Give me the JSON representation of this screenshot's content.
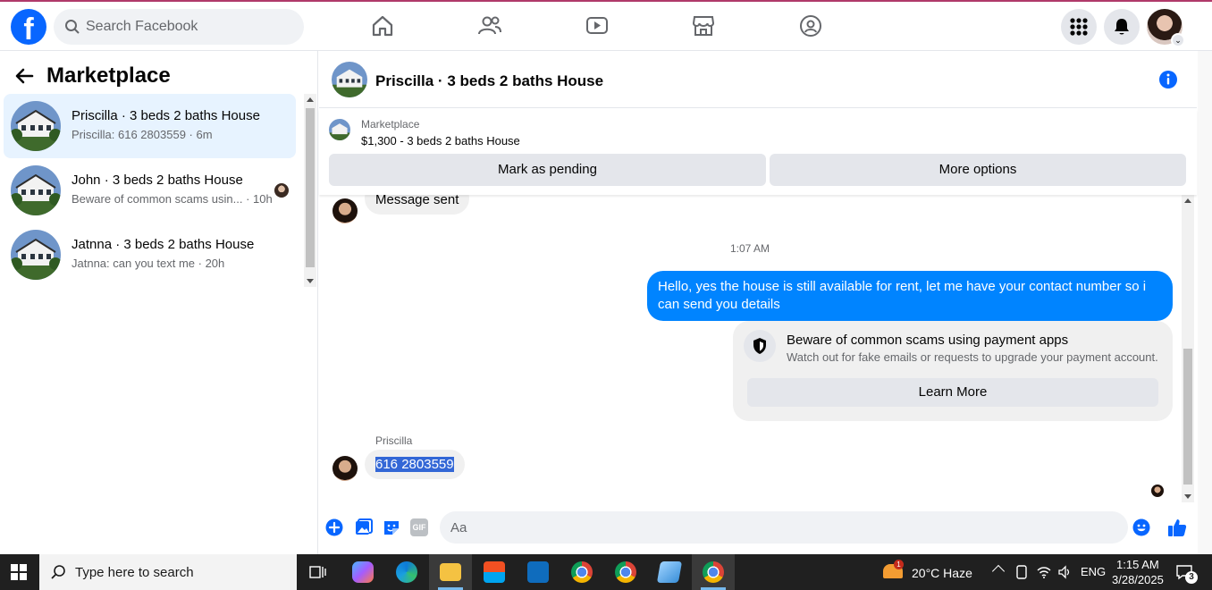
{
  "topbar": {
    "search_placeholder": "Search Facebook",
    "logo_letter": "f"
  },
  "left": {
    "title": "Marketplace",
    "conversations": [
      {
        "name": "Priscilla · 3 beds 2 baths House",
        "preview": "Priscilla: 616 2803559 · 6m",
        "active": true
      },
      {
        "name": "John · 3 beds 2 baths House",
        "preview": "Beware of common scams usin... · 10h",
        "active": false
      },
      {
        "name": "Jatnna · 3 beds 2 baths House",
        "preview": "Jatnna: can you text me · 20h",
        "active": false
      }
    ]
  },
  "chat": {
    "title": "Priscilla · 3 beds 2 baths House",
    "listing": {
      "category": "Marketplace",
      "price_title": "$1,300 - 3 beds 2 baths House",
      "mark_pending": "Mark as pending",
      "more_options": "More options"
    },
    "messages": {
      "sent_notice": "Message sent",
      "timestamp": "1:07 AM",
      "outgoing": "Hello, yes the house is still available for rent, let me have your contact number so i can send you details",
      "scam_title": "Beware of common scams using payment apps",
      "scam_desc": "Watch out for fake emails or requests to upgrade your payment account.",
      "learn_more": "Learn More",
      "sender": "Priscilla",
      "incoming": "616 2803559"
    },
    "composer_placeholder": "Aa",
    "gif_label": "GIF"
  },
  "taskbar": {
    "search_text": "Type here to search",
    "weather": "20°C  Haze",
    "weather_badge": "1",
    "language": "ENG",
    "time": "1:15 AM",
    "date": "3/28/2025",
    "notif_count": "3"
  },
  "colors": {
    "brand": "#0866ff",
    "bubble_out": "#0084ff",
    "active_row": "#e7f3ff",
    "taskbar": "#202020"
  }
}
